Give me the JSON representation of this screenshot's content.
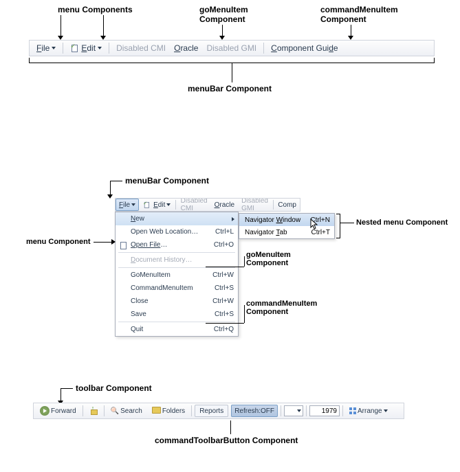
{
  "section1": {
    "labels": {
      "menu_components": "menu Components",
      "go_menu_item_component": "goMenuItem\nComponent",
      "command_menu_item_component": "commandMenuItem\nComponent",
      "menubar_component": "menuBar Component"
    },
    "items": {
      "file": "File",
      "edit": "Edit",
      "disabled_cmi": "Disabled CMI",
      "oracle": "Oracle",
      "disabled_gmi": "Disabled GMI",
      "component_guide": "Component Guide"
    }
  },
  "section2": {
    "labels": {
      "menubar_component": "menuBar Component",
      "menu_component": "menu Component",
      "nested_menu_component": "Nested menu Component",
      "go_menu_item_component": "goMenuItem\nComponent",
      "command_menu_item_component": "commandMenuItem\nComponent"
    },
    "menubar": {
      "file": "File",
      "edit": "Edit",
      "disabled_cmi": "Disabled CMI",
      "oracle": "Oracle",
      "disabled_gmi": "Disabled GMI",
      "comp": "Comp"
    },
    "dropdown": [
      {
        "label": "New",
        "underline": 0,
        "shortcut": "",
        "arrow": true
      },
      {
        "label": "Open Web Location…",
        "shortcut": "Ctrl+L"
      },
      {
        "label": "Open File…",
        "underline_range": "Open File",
        "shortcut": "Ctrl+O",
        "icon": true
      },
      {
        "label": "Document History…",
        "underline": 0,
        "shortcut": "",
        "disabled": true
      },
      {
        "label": "GoMenuItem",
        "shortcut": "Ctrl+W"
      },
      {
        "label": "CommandMenuItem",
        "shortcut": "Ctrl+S"
      },
      {
        "label": "Close",
        "shortcut": "Ctrl+W"
      },
      {
        "label": "Save",
        "shortcut": "Ctrl+S"
      },
      {
        "label": "Quit",
        "shortcut": "Ctrl+Q"
      }
    ],
    "submenu": [
      {
        "label": "Navigator Window",
        "underline": 10,
        "shortcut": "Ctrl+N",
        "highlight": true
      },
      {
        "label": "Navigator Tab",
        "underline": 10,
        "shortcut": "Ctrl+T"
      }
    ]
  },
  "section3": {
    "labels": {
      "toolbar_component": "toolbar Component",
      "command_toolbar_button_component": "commandToolbarButton Component"
    },
    "toolbar": {
      "forward": "Forward",
      "search": "Search",
      "folder": "Folders",
      "reports": "Reports",
      "refresh": "Refresh:OFF",
      "year": "1979",
      "arrange": "Arrange"
    }
  }
}
